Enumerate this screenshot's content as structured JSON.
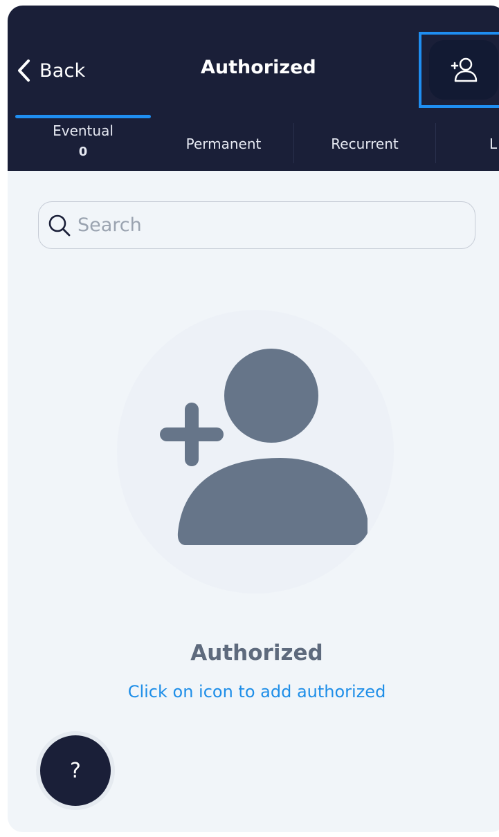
{
  "header": {
    "back_label": "Back",
    "title": "Authorized",
    "add_button_icon": "add-user-icon"
  },
  "tabs": [
    {
      "label": "Eventual",
      "count": "0",
      "active": true
    },
    {
      "label": "Permanent",
      "count": ""
    },
    {
      "label": "Recurrent",
      "count": ""
    },
    {
      "label": "L",
      "count": ""
    }
  ],
  "search": {
    "placeholder": "Search",
    "value": ""
  },
  "empty_state": {
    "icon": "add-user-icon",
    "title": "Authorized",
    "subtitle": "Click on icon to add authorized"
  },
  "help": {
    "label": "?"
  },
  "colors": {
    "navbar": "#1a1f38",
    "accent": "#1f8ef1",
    "background": "#f1f5f9",
    "icon_gray": "#667589",
    "link_blue": "#1e8ee8"
  }
}
